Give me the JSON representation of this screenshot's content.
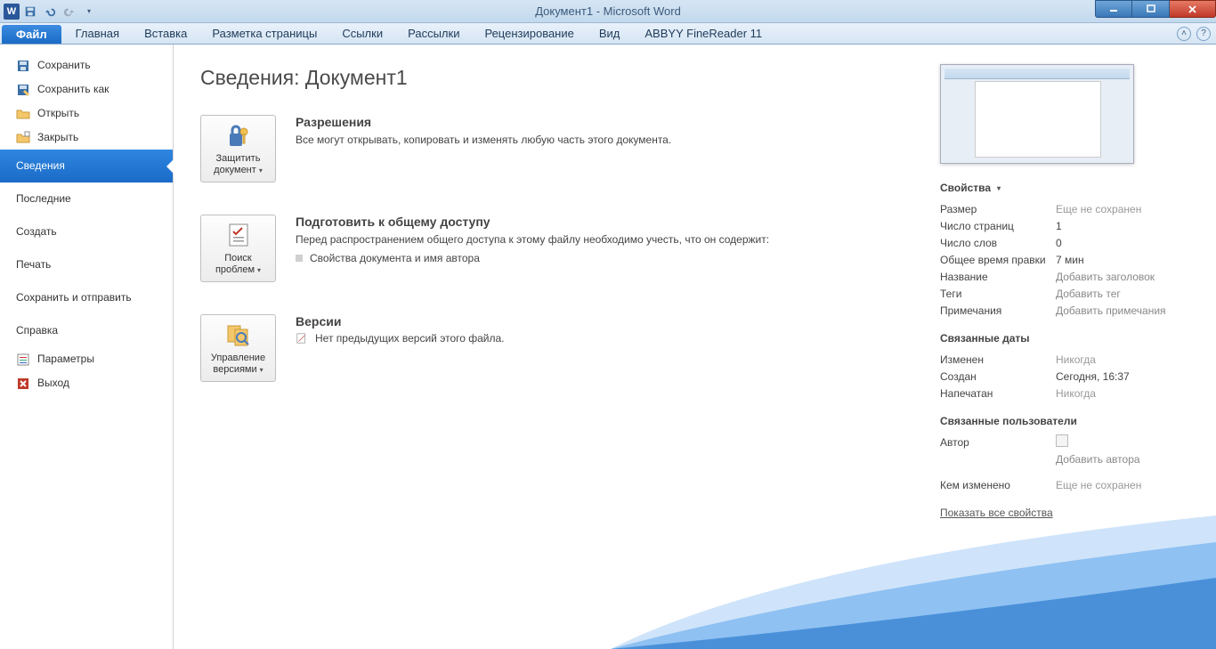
{
  "title": "Документ1  -  Microsoft Word",
  "ribbon": {
    "file": "Файл",
    "tabs": [
      "Главная",
      "Вставка",
      "Разметка страницы",
      "Ссылки",
      "Рассылки",
      "Рецензирование",
      "Вид",
      "ABBYY FineReader 11"
    ]
  },
  "nav": {
    "save": "Сохранить",
    "save_as": "Сохранить как",
    "open": "Открыть",
    "close": "Закрыть",
    "info": "Сведения",
    "recent": "Последние",
    "new": "Создать",
    "print": "Печать",
    "share": "Сохранить и отправить",
    "help": "Справка",
    "options": "Параметры",
    "exit": "Выход"
  },
  "content": {
    "title": "Сведения: Документ1",
    "permissions": {
      "btn": "Защитить документ",
      "heading": "Разрешения",
      "text": "Все могут открывать, копировать и изменять любую часть этого документа."
    },
    "prepare": {
      "btn": "Поиск проблем",
      "heading": "Подготовить к общему доступу",
      "text": "Перед распространением общего доступа к этому файлу необходимо учесть, что он содержит:",
      "bullet": "Свойства документа и имя автора"
    },
    "versions": {
      "btn": "Управление версиями",
      "heading": "Версии",
      "text": "Нет предыдущих версий этого файла."
    }
  },
  "props": {
    "header": "Свойства",
    "size_l": "Размер",
    "size_v": "Еще не сохранен",
    "pages_l": "Число страниц",
    "pages_v": "1",
    "words_l": "Число слов",
    "words_v": "0",
    "edit_l": "Общее время правки",
    "edit_v": "7 мин",
    "title_l": "Название",
    "title_v": "Добавить заголовок",
    "tags_l": "Теги",
    "tags_v": "Добавить тег",
    "comments_l": "Примечания",
    "comments_v": "Добавить примечания",
    "dates_hdr": "Связанные даты",
    "modified_l": "Изменен",
    "modified_v": "Никогда",
    "created_l": "Создан",
    "created_v": "Сегодня, 16:37",
    "printed_l": "Напечатан",
    "printed_v": "Никогда",
    "users_hdr": "Связанные пользователи",
    "author_l": "Автор",
    "author_add": "Добавить автора",
    "lastmod_l": "Кем изменено",
    "lastmod_v": "Еще не сохранен",
    "show_all": "Показать все свойства"
  }
}
